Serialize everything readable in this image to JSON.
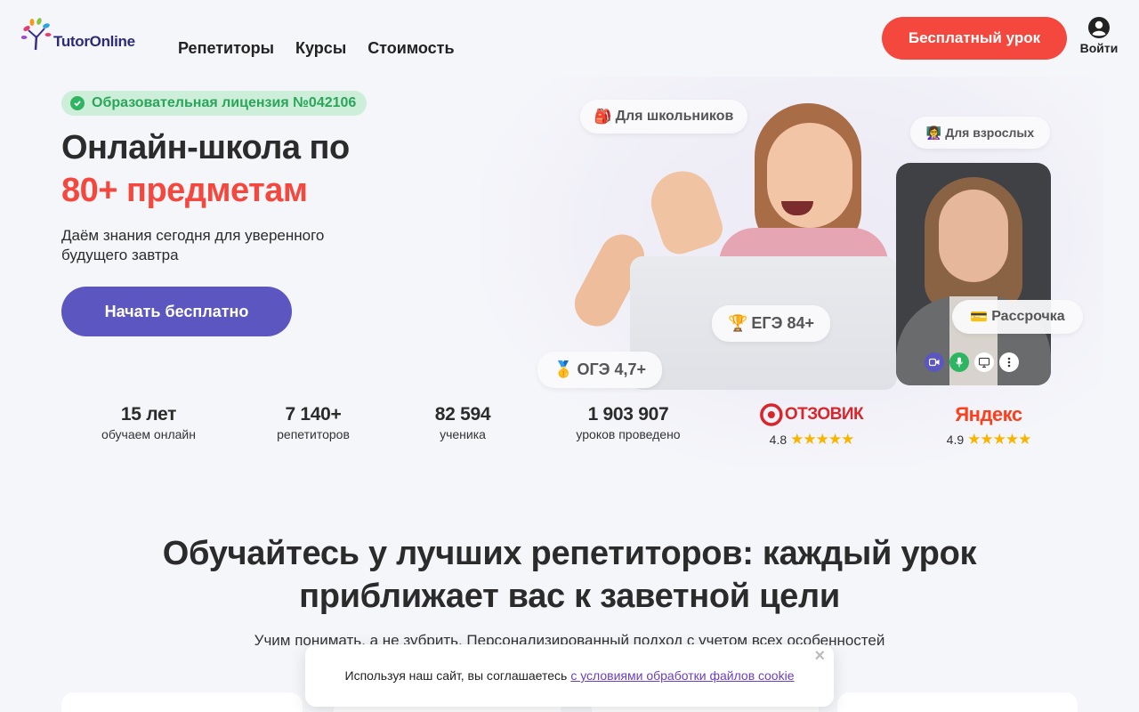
{
  "header": {
    "logo_text": "TutorOnline",
    "nav": [
      "Репетиторы",
      "Курсы",
      "Стоимость"
    ],
    "cta": "Бесплатный урок",
    "login": "Войти"
  },
  "hero": {
    "license": "Образовательная лицензия №042106",
    "title_line1": "Онлайн-школа по",
    "title_line2": "80+ предметам",
    "subtitle": "Даём знания сегодня для уверенного будущего завтра",
    "cta": "Начать бесплатно",
    "chips": {
      "schoolkids": "Для школьников",
      "adults": "Для взрослых",
      "installment": "Рассрочка",
      "ege": "ЕГЭ 84+",
      "oge": "ОГЭ 4,7+"
    },
    "chip_icons": {
      "schoolkids": "🎒",
      "adults": "👩‍🏫",
      "installment": "💳",
      "ege": "🏆",
      "oge": "🥇"
    }
  },
  "stats": [
    {
      "num": "15 лет",
      "label": "обучаем онлайн"
    },
    {
      "num": "7 140+",
      "label": "репетиторов"
    },
    {
      "num": "82 594",
      "label": "ученика"
    },
    {
      "num": "1 903 907",
      "label": "уроков проведено"
    }
  ],
  "reviews": [
    {
      "name": "ОТЗОВИК",
      "rating": "4.8",
      "stars": "★★★★★"
    },
    {
      "name": "Яндекс",
      "rating": "4.9",
      "stars": "★★★★★"
    }
  ],
  "section2": {
    "title": "Обучайтесь у лучших репетиторов: каждый урок приближает вас к заветной цели",
    "subtitle": "Учим понимать, а не зубрить. Персонализированный подход с учетом всех особенностей"
  },
  "cookie": {
    "text": "Используя наш сайт, вы соглашаетесь",
    "link": "с условиями обработки файлов cookie",
    "close": "×"
  },
  "colors": {
    "accent_red": "#f4473d",
    "accent_purple": "#5c56c0",
    "license_green": "#2aa55a",
    "star_yellow": "#f7b500"
  }
}
